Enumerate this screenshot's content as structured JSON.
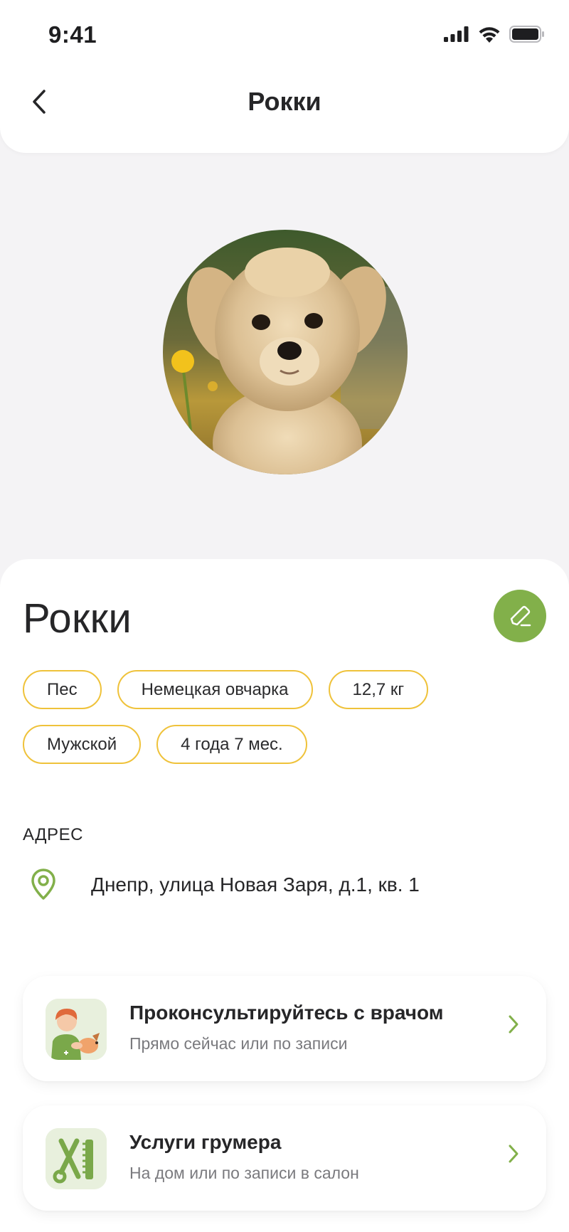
{
  "status_bar": {
    "time": "9:41"
  },
  "nav": {
    "title": "Рокки"
  },
  "pet": {
    "name": "Рокки",
    "tags_row1": [
      "Пес",
      "Немецкая овчарка",
      "12,7 кг"
    ],
    "tags_row2": [
      "Мужской",
      "4 года 7 мес."
    ]
  },
  "address": {
    "label": "АДРЕС",
    "value": "Днепр, улица Новая Заря, д.1, кв. 1"
  },
  "services": [
    {
      "title": "Проконсультируйтесь с врачом",
      "subtitle": "Прямо сейчас или по записи",
      "icon": "vet-doctor-icon"
    },
    {
      "title": "Услуги грумера",
      "subtitle": "На дом или по записи в салон",
      "icon": "grooming-tools-icon"
    }
  ],
  "colors": {
    "accent_green": "#82b04a",
    "tag_border": "#efc23a",
    "background": "#f4f3f5"
  }
}
